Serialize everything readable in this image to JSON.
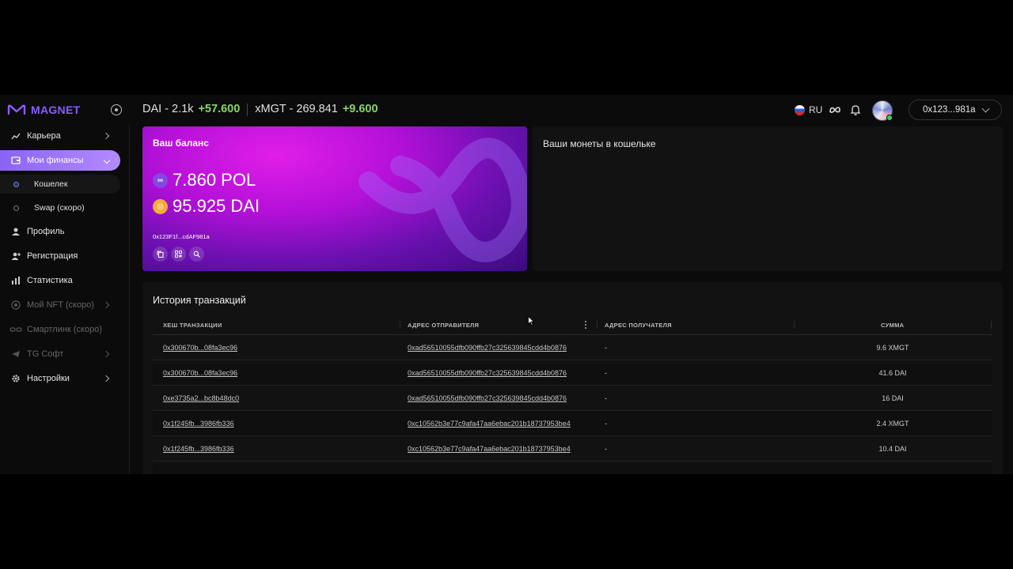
{
  "brand": {
    "name": "MAGNET",
    "color": "#8b5cf6"
  },
  "ticker": {
    "dai_label": "DAI - 2.1k",
    "dai_change": "+57.600",
    "xmgt_label": "xMGT - 269.841",
    "xmgt_change": "+9.600"
  },
  "header": {
    "language": "RU",
    "wallet_short": "0x123...981a"
  },
  "sidebar": {
    "items": [
      {
        "label": "Карьера",
        "icon": "chart-up-icon"
      },
      {
        "label": "Мои финансы",
        "icon": "wallet-icon"
      },
      {
        "label": "Профиль",
        "icon": "user-icon"
      },
      {
        "label": "Регистрация",
        "icon": "user-add-icon"
      },
      {
        "label": "Статистика",
        "icon": "bar-chart-icon"
      },
      {
        "label": "Мой NFT (скоро)",
        "icon": "nft-icon"
      },
      {
        "label": "Смартлинк (скоро)",
        "icon": "link-icon"
      },
      {
        "label": "TG Софт",
        "icon": "telegram-icon"
      },
      {
        "label": "Настройки",
        "icon": "gear-icon"
      }
    ],
    "sub_items": [
      {
        "label": "Кошелек"
      },
      {
        "label": "Swap (скоро)"
      }
    ]
  },
  "balance": {
    "title": "Ваш баланс",
    "pol": "7.860 POL",
    "dai": "95.925 DAI",
    "address": "0x123F1f...cdAF981a"
  },
  "coins_panel": {
    "title": "Ваши монеты в кошельке"
  },
  "transactions": {
    "title": "История транзакций",
    "columns": [
      "Хеш транзакции",
      "Адрес отправителя",
      "Адрес получателя",
      "Сумма"
    ],
    "rows": [
      {
        "hash": "0x300670b...08fa3ec96",
        "from": "0xad56510055dfb090ffb27c325639845cdd4b0876",
        "to": "-",
        "amount": "9.6 XMGT"
      },
      {
        "hash": "0x300670b...08fa3ec96",
        "from": "0xad56510055dfb090ffb27c325639845cdd4b0876",
        "to": "-",
        "amount": "41.6 DAI"
      },
      {
        "hash": "0xe3735a2...bc8b48dc0",
        "from": "0xad56510055dfb090ffb27c325639845cdd4b0876",
        "to": "-",
        "amount": "16 DAI"
      },
      {
        "hash": "0x1f245fb...3986fb336",
        "from": "0xc10562b3e77c9afa47aa6ebac201b18737953be4",
        "to": "-",
        "amount": "2.4 XMGT"
      },
      {
        "hash": "0x1f245fb...3986fb336",
        "from": "0xc10562b3e77c9afa47aa6ebac201b18737953be4",
        "to": "-",
        "amount": "10.4 DAI"
      }
    ]
  }
}
